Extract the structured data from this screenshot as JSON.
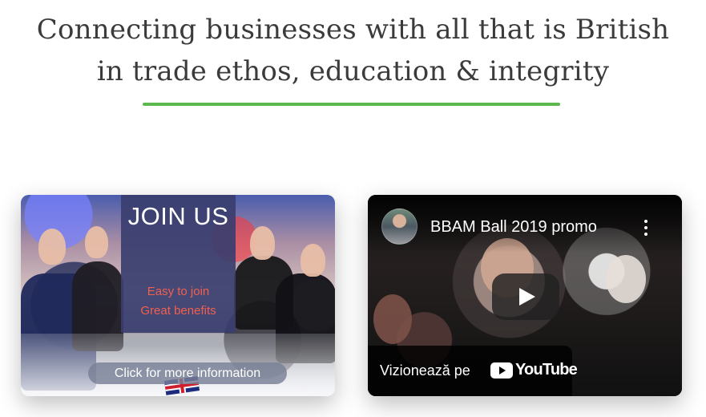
{
  "hero": {
    "headline_line_1": "Connecting businesses with all that is British",
    "headline_line_2": "in trade ethos, education & integrity",
    "rule_color": "#5cb84d"
  },
  "join_banner": {
    "title": "JOIN US",
    "line_1": "Easy to join",
    "line_2": "Great benefits",
    "button_label": "Click for more information",
    "accent_color": "#3a3e6f",
    "highlight_color": "#f0604f"
  },
  "video_card": {
    "title": "BBAM Ball 2019 promo",
    "watch_label": "Vizionează pe",
    "platform_name": "YouTube",
    "play_icon": "play-icon",
    "more_icon": "more-vertical-icon"
  }
}
